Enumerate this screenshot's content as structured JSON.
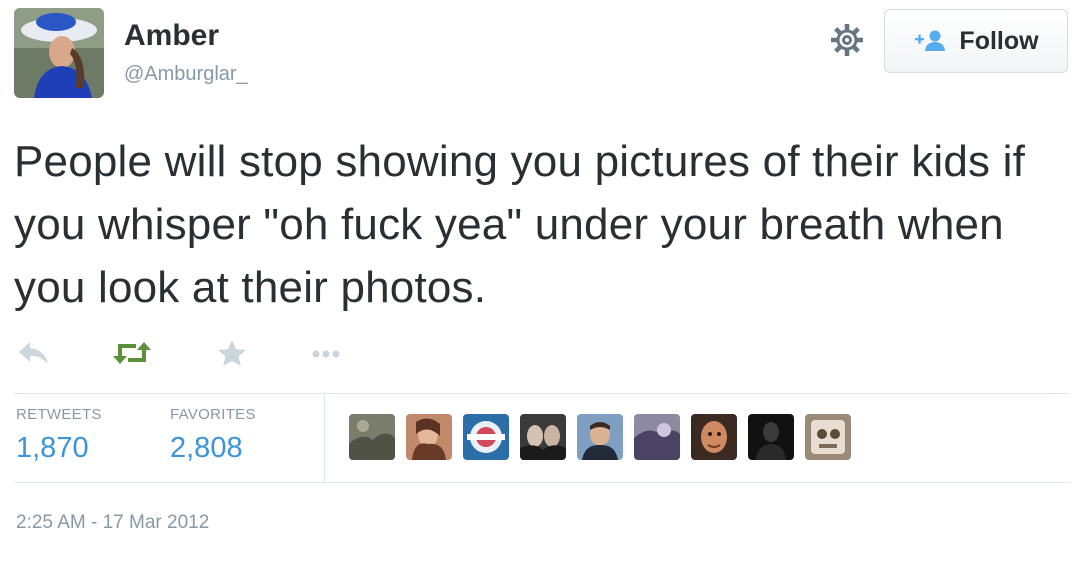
{
  "author": {
    "name": "Amber",
    "handle": "@Amburglar_"
  },
  "header": {
    "follow_label": "Follow"
  },
  "tweet": {
    "text": "People will stop showing you pictures of their kids if you whisper \"oh fuck yea\" under your breath when you look at their photos."
  },
  "stats": {
    "retweets_label": "RETWEETS",
    "retweets_count": "1,870",
    "favorites_label": "FAVORITES",
    "favorites_count": "2,808"
  },
  "favoriters_count_shown": 9,
  "timestamp": "2:25 AM - 17 Mar 2012",
  "colors": {
    "retweet_green": "#5c913b",
    "link_blue": "#3b94d9",
    "muted_gray": "#8899a6",
    "text_dark": "#292f33",
    "follow_icon_blue": "#55acee"
  },
  "icons": [
    "reply-icon",
    "retweet-icon",
    "favorite-icon",
    "more-icon",
    "gear-icon",
    "follow-user-icon"
  ]
}
